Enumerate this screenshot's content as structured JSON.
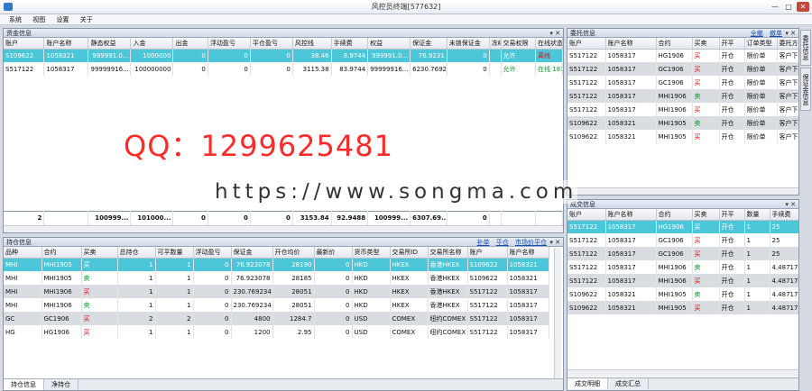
{
  "window": {
    "title": "风控员终端[577632]",
    "min": "—",
    "max": "□",
    "close": "✕"
  },
  "menu": [
    "系统",
    "视图",
    "设置",
    "关于"
  ],
  "panel_controls": "▾ ✕",
  "funds": {
    "title": "资金信息",
    "columns": [
      "账户",
      "账户名称",
      "静态权益",
      "入金",
      "出金",
      "浮动盈亏",
      "平仓盈亏",
      "风控线",
      "手续费",
      "权益",
      "保证金",
      "未锁保证金",
      "冻结",
      "交易权限",
      "在线状态"
    ],
    "rows": [
      [
        "S109622",
        "1058321",
        "999991.0...",
        "1000000",
        "0",
        "0",
        "0",
        "38.46",
        "8.9744",
        "999991.0...",
        "76.9231",
        "0",
        "",
        "允许",
        "离线"
      ],
      [
        "S517122",
        "1058317",
        "99999916...",
        "100000000",
        "0",
        "0",
        "0",
        "3115.38",
        "83.9744",
        "99999916...",
        "6230.7692",
        "0",
        "",
        "允许",
        "在线 183..."
      ]
    ],
    "totals": [
      "2",
      "",
      "100999...",
      "101000...",
      "0",
      "0",
      "0",
      "3153.84",
      "92.9488",
      "100999...",
      "6307.69...",
      "0",
      "",
      "",
      ""
    ]
  },
  "positions": {
    "title": "持仓信息",
    "links": [
      "补单",
      "平仓",
      "市场价平仓"
    ],
    "columns": [
      "品种",
      "合约",
      "买卖",
      "总持仓",
      "可平数量",
      "浮动盈亏",
      "保证金",
      "开仓均价",
      "最新价",
      "货币类型",
      "交易所ID",
      "交易所名称",
      "账户",
      "账户名称"
    ],
    "rows": [
      [
        "MHI",
        "MHI1905",
        "买",
        "1",
        "1",
        "0",
        "76.923078",
        "28190",
        "0",
        "HKD",
        "HKEX",
        "香港HKEX",
        "S109622",
        "1058321"
      ],
      [
        "MHI",
        "MHI1905",
        "卖",
        "1",
        "1",
        "0",
        "76.923078",
        "28185",
        "0",
        "HKD",
        "HKEX",
        "香港HKEX",
        "S109622",
        "1058321"
      ],
      [
        "MHI",
        "MHI1906",
        "买",
        "1",
        "1",
        "0",
        "230.769234",
        "28051",
        "0",
        "HKD",
        "HKEX",
        "香港HKEX",
        "S517122",
        "1058317"
      ],
      [
        "MHI",
        "MHI1906",
        "卖",
        "1",
        "1",
        "0",
        "230.769234",
        "28051",
        "0",
        "HKD",
        "HKEX",
        "香港HKEX",
        "S517122",
        "1058317"
      ],
      [
        "GC",
        "GC1906",
        "买",
        "2",
        "2",
        "0",
        "4800",
        "1284.7",
        "0",
        "USD",
        "COMEX",
        "纽约COMEX",
        "S517122",
        "1058317"
      ],
      [
        "HG",
        "HG1906",
        "买",
        "1",
        "1",
        "0",
        "1200",
        "2.95",
        "0",
        "USD",
        "COMEX",
        "纽约COMEX",
        "S517122",
        "1058317"
      ]
    ],
    "tabs": [
      "持仓信息",
      "净持仓"
    ]
  },
  "orders": {
    "title": "委托信息",
    "links": [
      "全撤",
      "撤单"
    ],
    "columns": [
      "账户",
      "账户名称",
      "合约",
      "买卖",
      "开平",
      "订单类型",
      "委托方"
    ],
    "rows": [
      [
        "S517122",
        "1058317",
        "HG1906",
        "买",
        "开仓",
        "限价单",
        "客户下"
      ],
      [
        "S517122",
        "1058317",
        "GC1906",
        "买",
        "开仓",
        "限价单",
        "客户下"
      ],
      [
        "S517122",
        "1058317",
        "GC1906",
        "买",
        "开仓",
        "限价单",
        "客户下"
      ],
      [
        "S517122",
        "1058317",
        "MHI1906",
        "卖",
        "开仓",
        "限价单",
        "客户下"
      ],
      [
        "S517122",
        "1058317",
        "MHI1906",
        "买",
        "开仓",
        "限价单",
        "客户下"
      ],
      [
        "S109622",
        "1058321",
        "MHI1905",
        "卖",
        "开仓",
        "限价单",
        "客户下"
      ],
      [
        "S109622",
        "1058321",
        "MHI1905",
        "买",
        "开仓",
        "限价单",
        "客户下"
      ]
    ]
  },
  "trades": {
    "title": "成交信息",
    "columns": [
      "账户",
      "账户名称",
      "合约",
      "买卖",
      "开平",
      "数量",
      "手续费"
    ],
    "rows": [
      [
        "S517122",
        "1058317",
        "HG1906",
        "买",
        "开仓",
        "1",
        "25"
      ],
      [
        "S517122",
        "1058317",
        "GC1906",
        "买",
        "开仓",
        "1",
        "25"
      ],
      [
        "S517122",
        "1058317",
        "GC1906",
        "买",
        "开仓",
        "1",
        "25"
      ],
      [
        "S517122",
        "1058317",
        "MHI1906",
        "卖",
        "开仓",
        "1",
        "4.487179"
      ],
      [
        "S517122",
        "1058317",
        "MHI1906",
        "买",
        "开仓",
        "1",
        "4.487179"
      ],
      [
        "S109622",
        "1058321",
        "MHI1905",
        "卖",
        "开仓",
        "1",
        "4.487179"
      ],
      [
        "S109622",
        "1058321",
        "MHI1905",
        "买",
        "开仓",
        "1",
        "4.487179"
      ]
    ],
    "tabs": [
      "成交明细",
      "成交汇总"
    ]
  },
  "side_tabs": [
    "委托信息",
    "保证金信息"
  ],
  "overlay": {
    "qq": "QQ：1299625481",
    "watermark": "https://www.songma.com"
  },
  "colors": {
    "buy": "#e01010",
    "sell": "#0b9a2b",
    "selected": "#4cc6d9",
    "alt_row": "#d9dde2"
  }
}
